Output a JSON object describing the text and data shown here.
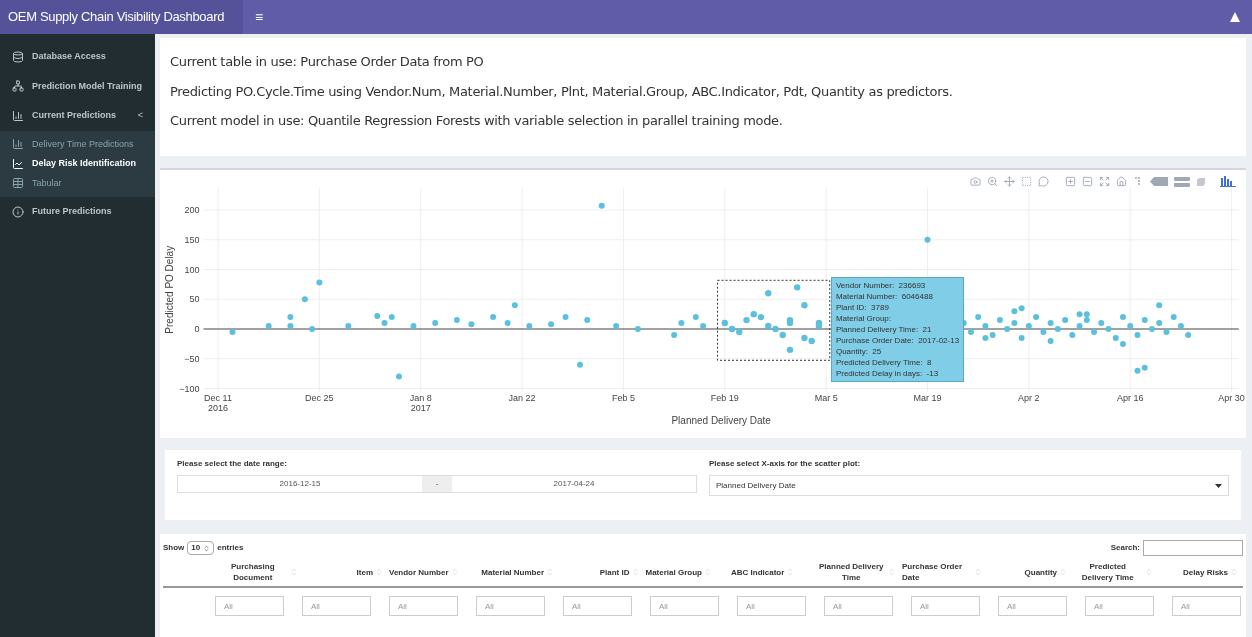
{
  "header": {
    "title": "OEM Supply Chain Visibility Dashboard",
    "menu_toggle": "≡"
  },
  "sidebar": {
    "items": [
      {
        "kind": "item",
        "label": "Database Access",
        "selected": false
      },
      {
        "kind": "item",
        "label": "Prediction Model Training",
        "selected": false
      },
      {
        "kind": "tree",
        "label": "Current Predictions",
        "caret": "<",
        "expanded": true,
        "selected": false,
        "children": [
          {
            "label": "Delivery Time Predictions",
            "selected": false
          },
          {
            "label": "Delay Risk Identification",
            "selected": true
          },
          {
            "label": "Tabular",
            "selected": false
          }
        ]
      },
      {
        "kind": "item",
        "label": "Future Predictions",
        "selected": false
      }
    ]
  },
  "info": [
    "Current table in use: Purchase Order Data from PO",
    "Predicting PO.Cycle.Time using Vendor.Num, Material.Number, Plnt, Material.Group, ABC.Indicator, Pdt, Quantity as predictors.",
    "Current model in use: Quantile Regression Forests with variable selection in parallel training mode."
  ],
  "chart": {
    "chart_data": {
      "type": "scatter",
      "xlabel": "Planned Delivery Date",
      "ylabel": "Predicted PO Delay",
      "grid": true,
      "xlim": [
        "2016-12-09",
        "2017-05-01"
      ],
      "ylim": [
        -105,
        237
      ],
      "xticks": [
        {
          "value": "2016-12-11",
          "label": "Dec 11\n2016"
        },
        {
          "value": "2016-12-25",
          "label": "Dec 25"
        },
        {
          "value": "2017-01-08",
          "label": "Jan 8\n2017"
        },
        {
          "value": "2017-01-22",
          "label": "Jan 22"
        },
        {
          "value": "2017-02-05",
          "label": "Feb 5"
        },
        {
          "value": "2017-02-19",
          "label": "Feb 19"
        },
        {
          "value": "2017-03-05",
          "label": "Mar 5"
        },
        {
          "value": "2017-03-19",
          "label": "Mar 19"
        },
        {
          "value": "2017-04-02",
          "label": "Apr 2"
        },
        {
          "value": "2017-04-16",
          "label": "Apr 16"
        },
        {
          "value": "2017-04-30",
          "label": "Apr 30"
        }
      ],
      "yticks": [
        {
          "value": -100,
          "label": "−100"
        },
        {
          "value": -50,
          "label": "−50"
        },
        0,
        50,
        100,
        150,
        200
      ],
      "x": [
        "2016-12-13",
        "2016-12-18",
        "2016-12-21",
        "2016-12-21",
        "2016-12-23",
        "2016-12-25",
        "2016-12-24",
        "2016-12-29",
        "2017-01-02",
        "2017-01-03",
        "2017-01-04",
        "2017-01-05",
        "2017-01-07",
        "2017-01-10",
        "2017-01-13",
        "2017-01-15",
        "2017-01-18",
        "2017-01-20",
        "2017-01-21",
        "2017-01-23",
        "2017-01-26",
        "2017-01-28",
        "2017-01-30",
        "2017-01-31",
        "2017-02-02",
        "2017-02-04",
        "2017-02-07",
        "2017-02-12",
        "2017-02-13",
        "2017-02-15",
        "2017-02-16",
        "2017-02-19",
        "2017-02-20",
        "2017-02-21",
        "2017-02-22",
        "2017-02-23",
        "2017-02-24",
        "2017-02-25",
        "2017-02-26",
        "2017-02-27",
        "2017-02-28",
        "2017-02-28",
        "2017-03-01",
        "2017-03-02",
        "2017-03-02",
        "2017-03-03",
        "2017-03-04",
        "2017-03-04",
        "2017-02-25",
        "2017-02-28",
        "2017-03-19",
        "2017-03-24",
        "2017-03-25",
        "2017-03-26",
        "2017-03-27",
        "2017-03-28",
        "2017-03-29",
        "2017-03-30",
        "2017-03-31",
        "2017-04-01",
        "2017-04-02",
        "2017-04-03",
        "2017-04-04",
        "2017-04-05",
        "2017-04-06",
        "2017-04-07",
        "2017-04-08",
        "2017-04-09",
        "2017-04-10",
        "2017-04-11",
        "2017-04-12",
        "2017-04-13",
        "2017-04-14",
        "2017-04-15",
        "2017-04-16",
        "2017-04-17",
        "2017-04-18",
        "2017-04-19",
        "2017-04-20",
        "2017-04-21",
        "2017-04-22",
        "2017-04-23",
        "2017-04-24",
        "2017-03-27",
        "2017-03-31",
        "2017-04-05",
        "2017-04-10",
        "2017-04-15",
        "2017-04-20",
        "2017-04-18",
        "2017-04-01",
        "2017-04-09",
        "2017-04-17"
      ],
      "series": [
        {
          "color": "#5bc0de",
          "values": [
            -5,
            5,
            20,
            5,
            50,
            78,
            0,
            5,
            22,
            10,
            20,
            -80,
            5,
            10,
            15,
            8,
            20,
            10,
            40,
            5,
            8,
            20,
            -60,
            15,
            207,
            5,
            0,
            -10,
            10,
            20,
            5,
            10,
            0,
            -5,
            15,
            25,
            20,
            5,
            0,
            -10,
            10,
            15,
            70,
            40,
            -15,
            -20,
            10,
            5,
            60,
            -35,
            150,
            10,
            -5,
            20,
            5,
            -10,
            15,
            0,
            10,
            -15,
            5,
            20,
            -5,
            10,
            0,
            15,
            -10,
            5,
            25,
            -5,
            10,
            0,
            -15,
            20,
            5,
            -10,
            15,
            0,
            10,
            -5,
            20,
            5,
            -10,
            -15,
            30,
            -20,
            15,
            -25,
            40,
            -65,
            35,
            25,
            -70
          ]
        }
      ]
    },
    "tooltip": "Vendor Number:  236693\nMaterial Number:  6046488\nPlant ID:  3789\nMaterial Group:\nPlanned Delivery Time:  21\nPurchase Order Date:  2017-02-13\nQuantity:  25\nPredicted Delivery Time:  8\nPredicted Delay in days:  -13"
  },
  "filters": {
    "date_range": {
      "label": "Please select the date range:",
      "start": "2016-12-15",
      "separator": "-",
      "end": "2017-04-24"
    },
    "x_axis": {
      "label": "Please select X-axis for the scatter plot:",
      "value": "Planned Delivery Date"
    }
  },
  "table": {
    "show_label": "Show",
    "length": "10",
    "entries_label": "entries",
    "search_label": "Search:",
    "columns": [
      {
        "label": "Purchasing Document",
        "filter_placeholder": "All"
      },
      {
        "label": "Item",
        "filter_placeholder": "All"
      },
      {
        "label": "Vendor Number",
        "filter_placeholder": "All"
      },
      {
        "label": "Material Number",
        "filter_placeholder": "All"
      },
      {
        "label": "Plant ID",
        "filter_placeholder": "All"
      },
      {
        "label": "Material Group",
        "filter_placeholder": "All"
      },
      {
        "label": "ABC Indicator",
        "filter_placeholder": "All"
      },
      {
        "label": "Planned Delivery Time",
        "filter_placeholder": "All"
      },
      {
        "label": "Purchase Order Date",
        "filter_placeholder": "All"
      },
      {
        "label": "Quantity",
        "filter_placeholder": "All"
      },
      {
        "label": "Predicted Delivery Time",
        "filter_placeholder": "All"
      },
      {
        "label": "Delay Risks",
        "filter_placeholder": "All"
      }
    ]
  }
}
